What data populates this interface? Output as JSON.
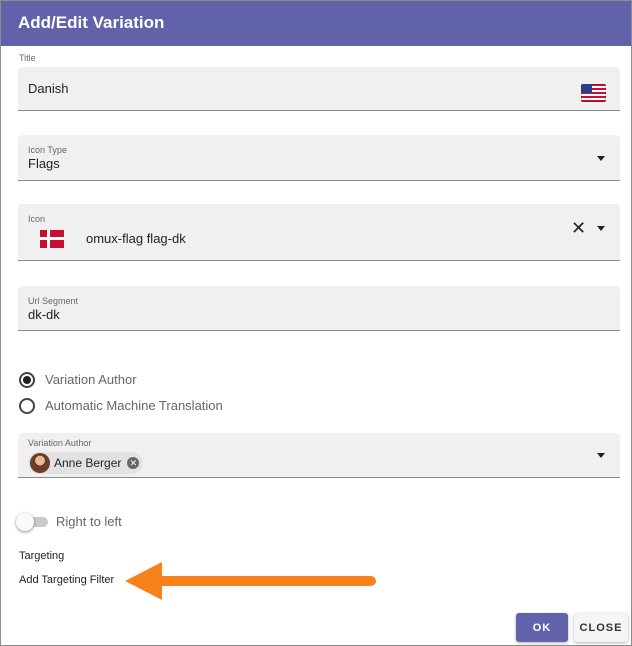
{
  "dialog": {
    "title": "Add/Edit Variation",
    "accent_color": "#6262aa"
  },
  "title_field": {
    "label": "Title",
    "value": "Danish",
    "icon": "us-flag-icon"
  },
  "icon_type_field": {
    "label": "Icon Type",
    "value": "Flags"
  },
  "icon_field": {
    "label": "Icon",
    "value": "omux-flag flag-dk",
    "icon": "danish-flag-icon",
    "clear_glyph": "✕"
  },
  "url_segment_field": {
    "label": "Url Segment",
    "value": "dk-dk"
  },
  "translation_mode": {
    "options": [
      {
        "label": "Variation Author",
        "checked": true
      },
      {
        "label": "Automatic Machine Translation",
        "checked": false
      }
    ]
  },
  "variation_author_field": {
    "label": "Variation Author",
    "chip_label": "Anne Berger",
    "chip_remove_glyph": "✕"
  },
  "rtl_toggle": {
    "label": "Right to left",
    "on": false
  },
  "targeting": {
    "heading": "Targeting",
    "add_filter_label": "Add Targeting Filter",
    "annotation_color": "#f7821b"
  },
  "actions": {
    "ok_label": "OK",
    "close_label": "CLOSE"
  }
}
